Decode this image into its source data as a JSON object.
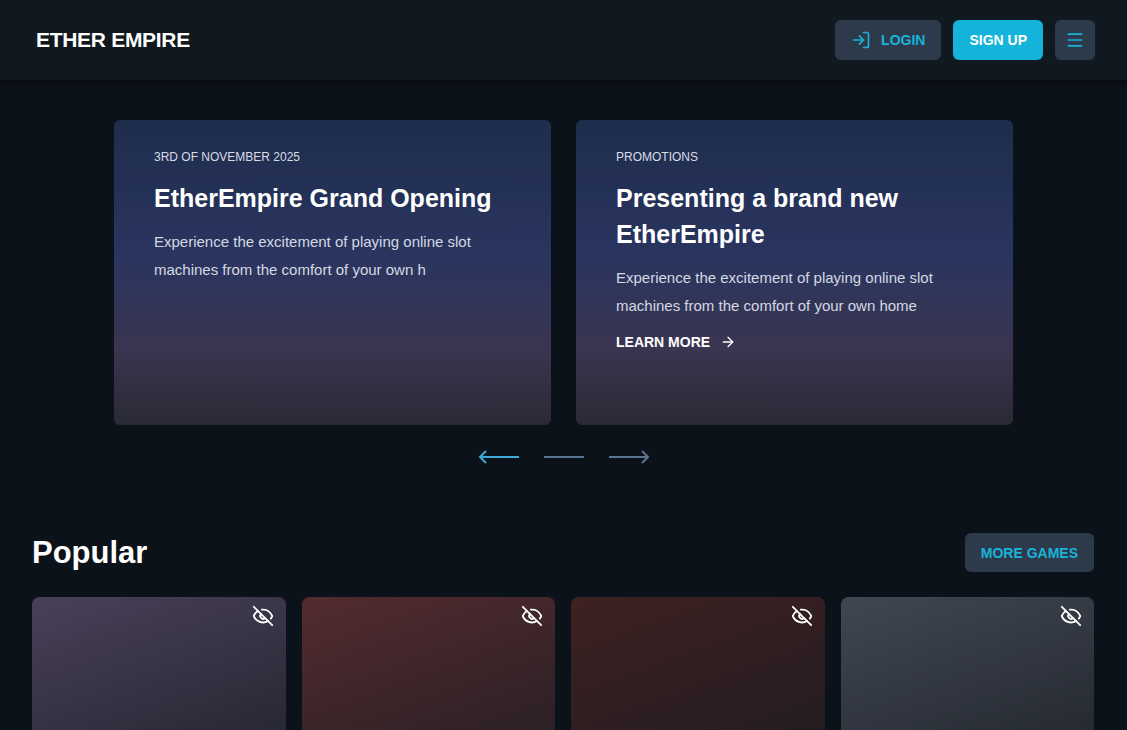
{
  "header": {
    "logo": "ETHER EMPIRE",
    "login": "LOGIN",
    "signup": "SIGN UP"
  },
  "slides": [
    {
      "label": "3RD OF NOVEMBER 2025",
      "title": "EtherEmpire Grand Opening",
      "text": "Experience the excitement of playing online slot machines from the comfort of your own h",
      "link": ""
    },
    {
      "label": "PROMOTIONS",
      "title": "Presenting a brand new EtherEmpire",
      "text": "Experience the excitement of playing online slot machines from the comfort of your own home",
      "link": "LEARN MORE"
    }
  ],
  "carousel": {
    "prev_active": true,
    "next_active": false
  },
  "popular": {
    "title": "Popular",
    "button": "MORE GAMES",
    "games": [
      {
        "color": "#6b5a7a",
        "hidden": true
      },
      {
        "color": "#7a3a3a",
        "hidden": true
      },
      {
        "color": "#5a2a26",
        "hidden": true
      },
      {
        "color": "#5e6470",
        "hidden": true
      }
    ]
  }
}
